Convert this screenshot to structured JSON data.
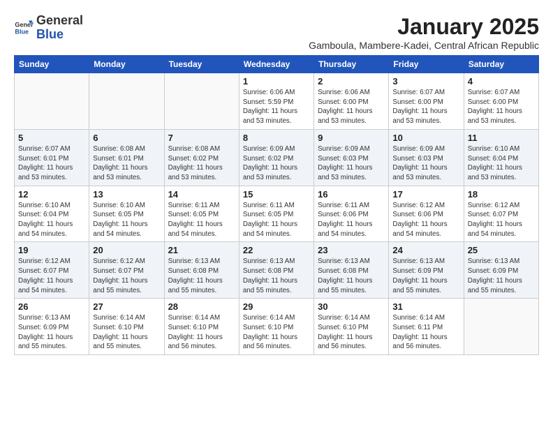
{
  "header": {
    "logo_general": "General",
    "logo_blue": "Blue",
    "month_title": "January 2025",
    "subtitle": "Gamboula, Mambere-Kadei, Central African Republic"
  },
  "weekdays": [
    "Sunday",
    "Monday",
    "Tuesday",
    "Wednesday",
    "Thursday",
    "Friday",
    "Saturday"
  ],
  "weeks": [
    [
      {
        "day": "",
        "sunrise": "",
        "sunset": "",
        "daylight": ""
      },
      {
        "day": "",
        "sunrise": "",
        "sunset": "",
        "daylight": ""
      },
      {
        "day": "",
        "sunrise": "",
        "sunset": "",
        "daylight": ""
      },
      {
        "day": "1",
        "sunrise": "Sunrise: 6:06 AM",
        "sunset": "Sunset: 5:59 PM",
        "daylight": "Daylight: 11 hours and 53 minutes."
      },
      {
        "day": "2",
        "sunrise": "Sunrise: 6:06 AM",
        "sunset": "Sunset: 6:00 PM",
        "daylight": "Daylight: 11 hours and 53 minutes."
      },
      {
        "day": "3",
        "sunrise": "Sunrise: 6:07 AM",
        "sunset": "Sunset: 6:00 PM",
        "daylight": "Daylight: 11 hours and 53 minutes."
      },
      {
        "day": "4",
        "sunrise": "Sunrise: 6:07 AM",
        "sunset": "Sunset: 6:00 PM",
        "daylight": "Daylight: 11 hours and 53 minutes."
      }
    ],
    [
      {
        "day": "5",
        "sunrise": "Sunrise: 6:07 AM",
        "sunset": "Sunset: 6:01 PM",
        "daylight": "Daylight: 11 hours and 53 minutes."
      },
      {
        "day": "6",
        "sunrise": "Sunrise: 6:08 AM",
        "sunset": "Sunset: 6:01 PM",
        "daylight": "Daylight: 11 hours and 53 minutes."
      },
      {
        "day": "7",
        "sunrise": "Sunrise: 6:08 AM",
        "sunset": "Sunset: 6:02 PM",
        "daylight": "Daylight: 11 hours and 53 minutes."
      },
      {
        "day": "8",
        "sunrise": "Sunrise: 6:09 AM",
        "sunset": "Sunset: 6:02 PM",
        "daylight": "Daylight: 11 hours and 53 minutes."
      },
      {
        "day": "9",
        "sunrise": "Sunrise: 6:09 AM",
        "sunset": "Sunset: 6:03 PM",
        "daylight": "Daylight: 11 hours and 53 minutes."
      },
      {
        "day": "10",
        "sunrise": "Sunrise: 6:09 AM",
        "sunset": "Sunset: 6:03 PM",
        "daylight": "Daylight: 11 hours and 53 minutes."
      },
      {
        "day": "11",
        "sunrise": "Sunrise: 6:10 AM",
        "sunset": "Sunset: 6:04 PM",
        "daylight": "Daylight: 11 hours and 53 minutes."
      }
    ],
    [
      {
        "day": "12",
        "sunrise": "Sunrise: 6:10 AM",
        "sunset": "Sunset: 6:04 PM",
        "daylight": "Daylight: 11 hours and 54 minutes."
      },
      {
        "day": "13",
        "sunrise": "Sunrise: 6:10 AM",
        "sunset": "Sunset: 6:05 PM",
        "daylight": "Daylight: 11 hours and 54 minutes."
      },
      {
        "day": "14",
        "sunrise": "Sunrise: 6:11 AM",
        "sunset": "Sunset: 6:05 PM",
        "daylight": "Daylight: 11 hours and 54 minutes."
      },
      {
        "day": "15",
        "sunrise": "Sunrise: 6:11 AM",
        "sunset": "Sunset: 6:05 PM",
        "daylight": "Daylight: 11 hours and 54 minutes."
      },
      {
        "day": "16",
        "sunrise": "Sunrise: 6:11 AM",
        "sunset": "Sunset: 6:06 PM",
        "daylight": "Daylight: 11 hours and 54 minutes."
      },
      {
        "day": "17",
        "sunrise": "Sunrise: 6:12 AM",
        "sunset": "Sunset: 6:06 PM",
        "daylight": "Daylight: 11 hours and 54 minutes."
      },
      {
        "day": "18",
        "sunrise": "Sunrise: 6:12 AM",
        "sunset": "Sunset: 6:07 PM",
        "daylight": "Daylight: 11 hours and 54 minutes."
      }
    ],
    [
      {
        "day": "19",
        "sunrise": "Sunrise: 6:12 AM",
        "sunset": "Sunset: 6:07 PM",
        "daylight": "Daylight: 11 hours and 54 minutes."
      },
      {
        "day": "20",
        "sunrise": "Sunrise: 6:12 AM",
        "sunset": "Sunset: 6:07 PM",
        "daylight": "Daylight: 11 hours and 55 minutes."
      },
      {
        "day": "21",
        "sunrise": "Sunrise: 6:13 AM",
        "sunset": "Sunset: 6:08 PM",
        "daylight": "Daylight: 11 hours and 55 minutes."
      },
      {
        "day": "22",
        "sunrise": "Sunrise: 6:13 AM",
        "sunset": "Sunset: 6:08 PM",
        "daylight": "Daylight: 11 hours and 55 minutes."
      },
      {
        "day": "23",
        "sunrise": "Sunrise: 6:13 AM",
        "sunset": "Sunset: 6:08 PM",
        "daylight": "Daylight: 11 hours and 55 minutes."
      },
      {
        "day": "24",
        "sunrise": "Sunrise: 6:13 AM",
        "sunset": "Sunset: 6:09 PM",
        "daylight": "Daylight: 11 hours and 55 minutes."
      },
      {
        "day": "25",
        "sunrise": "Sunrise: 6:13 AM",
        "sunset": "Sunset: 6:09 PM",
        "daylight": "Daylight: 11 hours and 55 minutes."
      }
    ],
    [
      {
        "day": "26",
        "sunrise": "Sunrise: 6:13 AM",
        "sunset": "Sunset: 6:09 PM",
        "daylight": "Daylight: 11 hours and 55 minutes."
      },
      {
        "day": "27",
        "sunrise": "Sunrise: 6:14 AM",
        "sunset": "Sunset: 6:10 PM",
        "daylight": "Daylight: 11 hours and 55 minutes."
      },
      {
        "day": "28",
        "sunrise": "Sunrise: 6:14 AM",
        "sunset": "Sunset: 6:10 PM",
        "daylight": "Daylight: 11 hours and 56 minutes."
      },
      {
        "day": "29",
        "sunrise": "Sunrise: 6:14 AM",
        "sunset": "Sunset: 6:10 PM",
        "daylight": "Daylight: 11 hours and 56 minutes."
      },
      {
        "day": "30",
        "sunrise": "Sunrise: 6:14 AM",
        "sunset": "Sunset: 6:10 PM",
        "daylight": "Daylight: 11 hours and 56 minutes."
      },
      {
        "day": "31",
        "sunrise": "Sunrise: 6:14 AM",
        "sunset": "Sunset: 6:11 PM",
        "daylight": "Daylight: 11 hours and 56 minutes."
      },
      {
        "day": "",
        "sunrise": "",
        "sunset": "",
        "daylight": ""
      }
    ]
  ]
}
